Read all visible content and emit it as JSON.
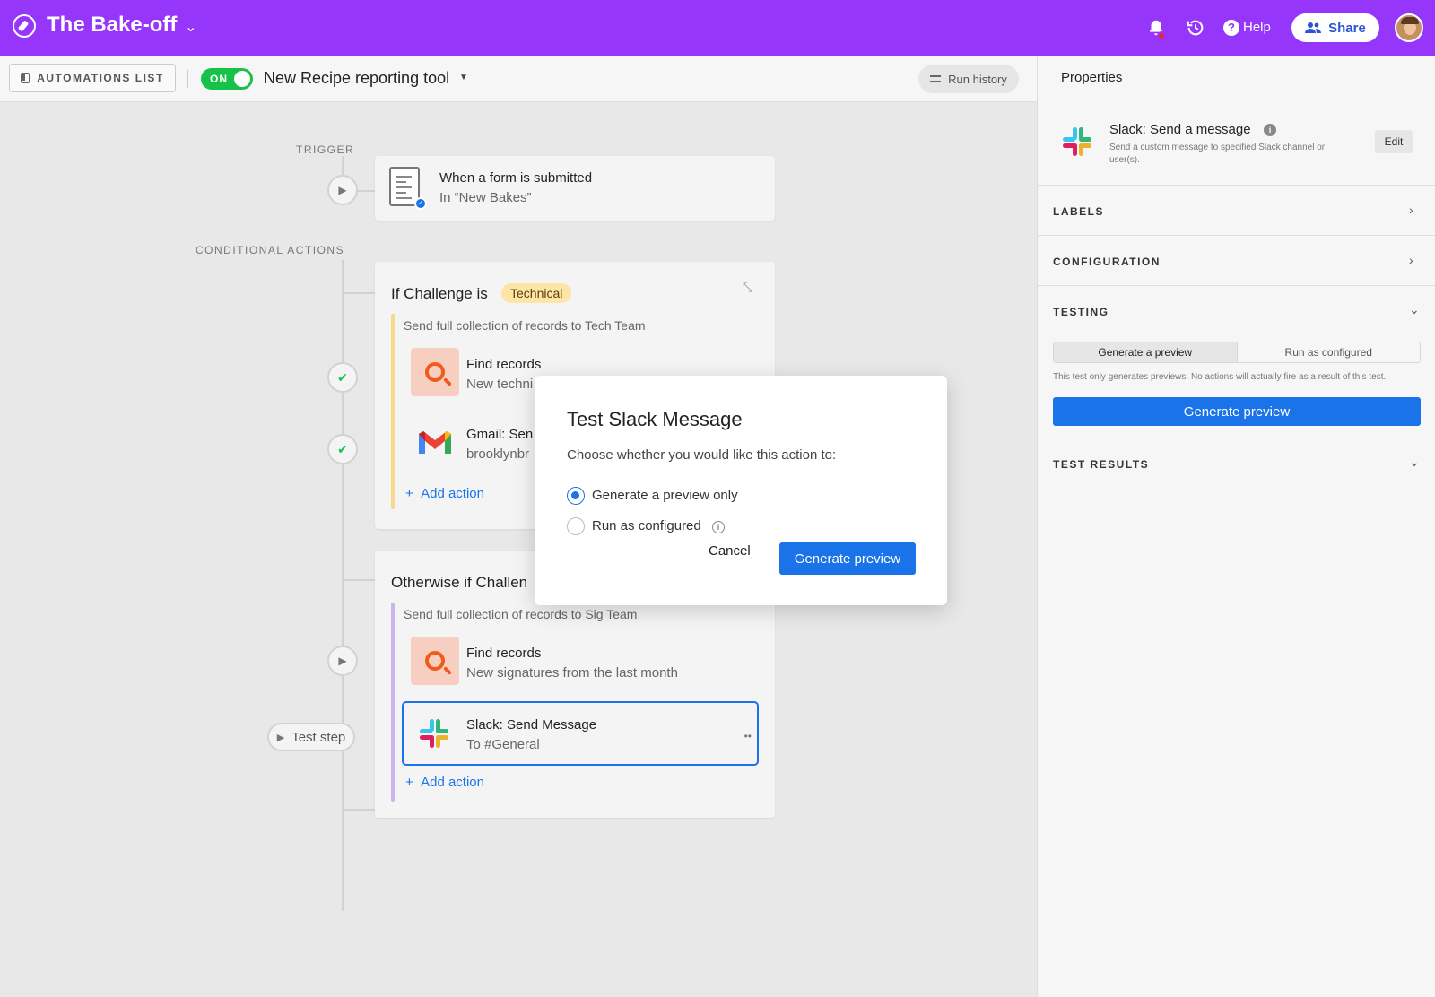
{
  "header": {
    "base_title": "The Bake-off",
    "help_label": "Help",
    "share_label": "Share"
  },
  "toolbar": {
    "automations_list_label": "AUTOMATIONS LIST",
    "toggle_label": "ON",
    "automation_name": "New Recipe reporting tool",
    "run_history_label": "Run history"
  },
  "canvas": {
    "trigger_label": "TRIGGER",
    "conditional_label": "CONDITIONAL ACTIONS",
    "trigger": {
      "title": "When a form is submitted",
      "subtitle": "In “New Bakes”"
    },
    "condition1": {
      "title": "If Challenge is",
      "tag": "Technical",
      "description": "Send full collection of records to Tech Team",
      "action1_title": "Find records",
      "action1_sub": "New techni",
      "action2_title": "Gmail: Sen",
      "action2_sub": "brooklynbr",
      "add_action": "Add action"
    },
    "condition2": {
      "title": "Otherwise if Challen",
      "description": "Send full collection of records to Sig Team",
      "action1_title": "Find records",
      "action1_sub": "New signatures from the last month",
      "action2_title": "Slack: Send Message",
      "action2_sub": "To #General",
      "add_action": "Add action"
    },
    "test_step_label": "Test step"
  },
  "modal": {
    "title": "Test Slack Message",
    "description": "Choose whether you would like this action to:",
    "option1": "Generate a preview only",
    "option2": "Run as configured",
    "cancel_label": "Cancel",
    "generate_label": "Generate preview",
    "selected_option": "Generate a preview only"
  },
  "properties": {
    "title": "Properties",
    "action_title": "Slack: Send a message",
    "action_desc": "Send a custom message to specified Slack channel or user(s).",
    "edit_label": "Edit",
    "labels_label": "LABELS",
    "configuration_label": "CONFIGURATION",
    "testing_label": "TESTING",
    "seg_option1": "Generate a preview",
    "seg_option2": "Run as configured",
    "testing_note": "This test only generates previews. No actions will actually fire as a result of this test.",
    "generate_label": "Generate preview",
    "test_results_label": "TEST RESULTS"
  },
  "colors": {
    "brand_purple": "#9536fa",
    "primary_blue": "#1a73e8",
    "toggle_green": "#16c24a",
    "technical_tag": "#fde5a7"
  }
}
